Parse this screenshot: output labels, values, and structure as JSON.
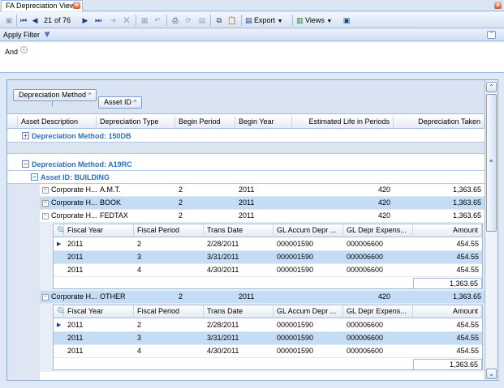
{
  "tab": {
    "title": "FA Depreciation View"
  },
  "toolbar": {
    "record_position": "21",
    "record_of": "of 76",
    "export_label": "Export",
    "views_label": "Views"
  },
  "filter": {
    "title": "Apply Filter",
    "and_label": "And"
  },
  "grouping": {
    "level1": "Depreciation Method",
    "level2": "Asset ID"
  },
  "columns": [
    "Asset Description",
    "Depreciation Type",
    "Begin Period",
    "Begin Year",
    "Estimated Life in Periods",
    "Depreciation Taken"
  ],
  "groups": {
    "g1": "Depreciation Method: 150DB",
    "g2": "Depreciation Method: A19RC",
    "g2_asset": "Asset ID: BUILDING"
  },
  "rows": [
    {
      "desc": "Corporate H...",
      "type": "A.M.T.",
      "period": "2",
      "year": "2011",
      "life": "420",
      "taken": "1,363.65"
    },
    {
      "desc": "Corporate H...",
      "type": "BOOK",
      "period": "2",
      "year": "2011",
      "life": "420",
      "taken": "1,363.65"
    },
    {
      "desc": "Corporate H...",
      "type": "FEDTAX",
      "period": "2",
      "year": "2011",
      "life": "420",
      "taken": "1,363.65"
    },
    {
      "desc": "Corporate H...",
      "type": "OTHER",
      "period": "2",
      "year": "2011",
      "life": "420",
      "taken": "1,363.65"
    }
  ],
  "sub_columns": [
    "Fiscal Year",
    "Fiscal Period",
    "Trans Date",
    "GL Accum Depr ...",
    "GL Depr Expens...",
    "Amount"
  ],
  "detail1": [
    {
      "fy": "2011",
      "fp": "2",
      "date": "2/28/2011",
      "accum": "000001590",
      "expense": "000006600",
      "amount": "454.55"
    },
    {
      "fy": "2011",
      "fp": "3",
      "date": "3/31/2011",
      "accum": "000001590",
      "expense": "000006600",
      "amount": "454.55"
    },
    {
      "fy": "2011",
      "fp": "4",
      "date": "4/30/2011",
      "accum": "000001590",
      "expense": "000006600",
      "amount": "454.55"
    }
  ],
  "detail1_total": "1,363.65",
  "detail2": [
    {
      "fy": "2011",
      "fp": "2",
      "date": "2/28/2011",
      "accum": "000001590",
      "expense": "000006600",
      "amount": "454.55"
    },
    {
      "fy": "2011",
      "fp": "3",
      "date": "3/31/2011",
      "accum": "000001590",
      "expense": "000006600",
      "amount": "454.55"
    },
    {
      "fy": "2011",
      "fp": "4",
      "date": "4/30/2011",
      "accum": "000001590",
      "expense": "000006600",
      "amount": "454.55"
    }
  ],
  "detail2_total": "1,363.65"
}
